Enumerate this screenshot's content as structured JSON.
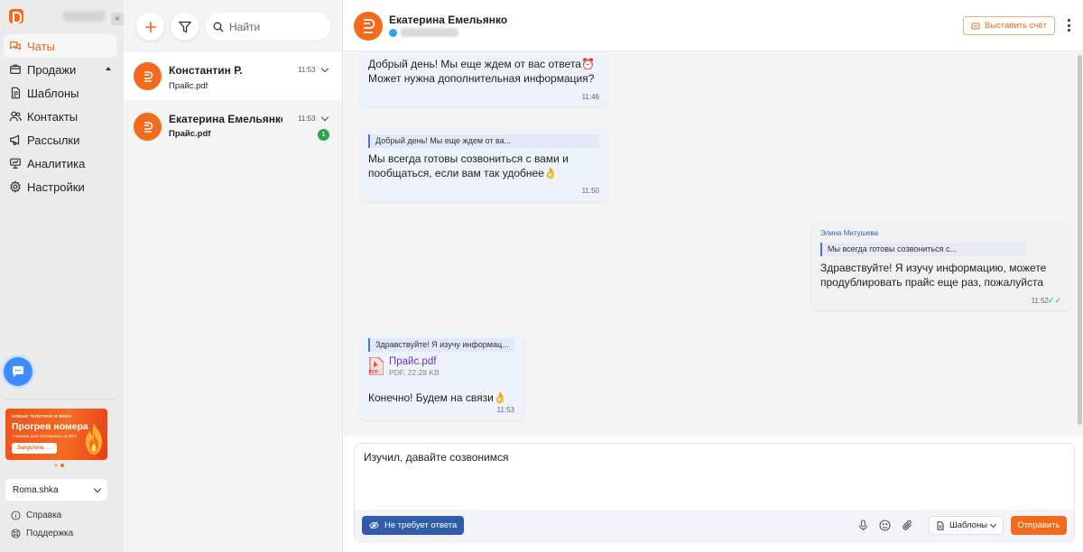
{
  "sidebar": {
    "collapse_glyph": "«",
    "items": [
      {
        "label": "Чаты",
        "icon": "chat-bubbles-icon",
        "active": true
      },
      {
        "label": "Продажи",
        "icon": "sales-box-icon"
      },
      {
        "label": "Шаблоны",
        "icon": "document-icon"
      },
      {
        "label": "Контакты",
        "icon": "contacts-icon"
      },
      {
        "label": "Рассылки",
        "icon": "megaphone-icon"
      },
      {
        "label": "Аналитика",
        "icon": "analytics-icon"
      },
      {
        "label": "Настройки",
        "icon": "gear-icon"
      }
    ],
    "promo": {
      "top_line": "НОВЫЕ ТЕЛЕГРАМ И WABA",
      "title": "Прогрев номера",
      "subtitle": "Снижаем риск блокировки на 90%",
      "button": "Запустить →"
    },
    "account": "Roma.shka",
    "help": "Справка",
    "support": "Поддержка"
  },
  "chat_list": {
    "search_placeholder": "Найти",
    "dialogs": [
      {
        "name": "Константин Р.",
        "time": "11:53",
        "last": "Прайс.pdf",
        "selected": true
      },
      {
        "name": "Екатерина Емельянко",
        "time": "11:53",
        "last": "Прайс.pdf",
        "unread": "1"
      }
    ]
  },
  "conversation": {
    "contact_name": "Екатерина Емельянко",
    "invoice_button": "Выставить счёт",
    "messages": [
      {
        "text": "Добрый день! Мы еще ждем от вас ответа⏰\nМожет нужна дополнительная информация?",
        "time": "11:46"
      },
      {
        "quote": "Добрый день! Мы еще ждем от ва...",
        "text": "Мы всегда готовы созвониться с вами и\nпообщаться, если вам так удобнее👌",
        "time": "11:50"
      },
      {
        "author": "Элина Митушева",
        "quote": "Мы всегда готовы созвониться с...",
        "text": "Здравствуйте! Я изучу информацию, можете\nпродублировать прайс еще раз, пожалуйста",
        "time": "11:52",
        "status": "✓✓"
      },
      {
        "quote": "Здравствуйте! Я изучу информац...",
        "file_name": "Прайс.pdf",
        "file_meta": "PDF, 22.28 KB",
        "file_badge": "PDF",
        "text": "Конечно! Будем на связи👌",
        "time": "11:53"
      }
    ]
  },
  "composer": {
    "draft": "Изучил, давайте созвонимся",
    "no_reply_button": "Не требует ответа",
    "templates_button": "Шаблоны",
    "send_button": "Отправить"
  },
  "colors": {
    "accent": "#f26a1b",
    "primary_blue": "#2f5daa",
    "unread_green": "#29a843"
  }
}
